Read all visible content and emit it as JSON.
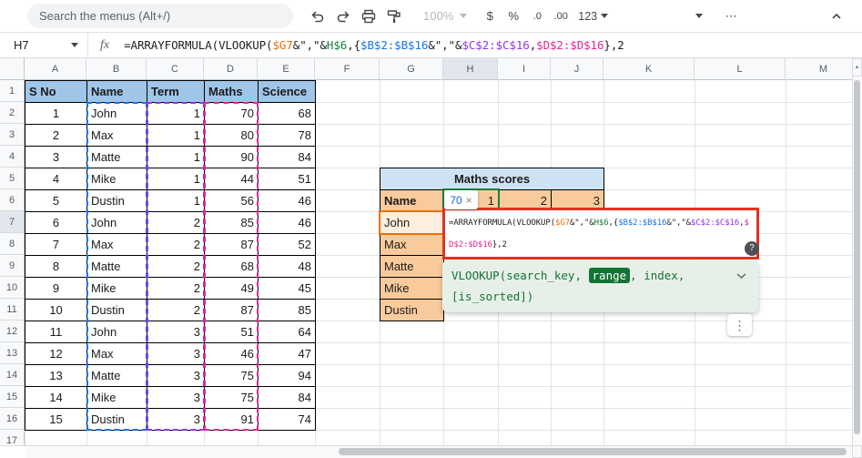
{
  "colors": {
    "ref_orange": "#e8710a",
    "ref_green": "#188038",
    "ref_blue": "#1a73e8",
    "ref_purple": "#9334e6",
    "ref_pink": "#e52592",
    "annotation_red": "#e43222",
    "table1_header_bg": "#9fc5e8",
    "table2_title_bg": "#cfe2f3",
    "table2_header_bg": "#f9cb9c",
    "referenced_cell_bg": "#fdeedd",
    "hint_bg": "#e7f0e8",
    "hint_green": "#137333"
  },
  "toolbar": {
    "search_label": "Search the menus (Alt+/)",
    "zoom_value": "100%",
    "currency_label": "$",
    "percent_label": "%",
    "decrease_decimal_label": ".0",
    "increase_decimal_label": ".00",
    "number_format_label": "123",
    "more_label": "⋯"
  },
  "formula_bar": {
    "cell_ref": "H7",
    "fx_label": "fx",
    "segments": [
      {
        "t": "=ARRAYFORMULA(VLOOKUP(",
        "c": null
      },
      {
        "t": "$G7",
        "c": "ref_orange"
      },
      {
        "t": "&\",\"&",
        "c": null
      },
      {
        "t": "H$6",
        "c": "ref_green"
      },
      {
        "t": ",{",
        "c": null
      },
      {
        "t": "$B$2:$B$16",
        "c": "ref_blue"
      },
      {
        "t": "&\",\"&",
        "c": null
      },
      {
        "t": "$C$2:$C$16",
        "c": "ref_purple"
      },
      {
        "t": ",",
        "c": null
      },
      {
        "t": "$D$2:$D$16",
        "c": "ref_pink"
      },
      {
        "t": "},2",
        "c": null
      }
    ]
  },
  "grid": {
    "column_headers": [
      "A",
      "B",
      "C",
      "D",
      "E",
      "F",
      "G",
      "H",
      "I",
      "J",
      "K",
      "L",
      "M"
    ],
    "row_headers": [
      "1",
      "2",
      "3",
      "4",
      "5",
      "6",
      "7",
      "8",
      "9",
      "10",
      "11",
      "12",
      "13",
      "14",
      "15",
      "16",
      "17"
    ],
    "selected_column": "H",
    "selected_row": "7"
  },
  "scores_table": {
    "headers": [
      "S No",
      "Name",
      "Term",
      "Maths",
      "Science"
    ],
    "rows": [
      [
        "1",
        "John",
        "1",
        "70",
        "68"
      ],
      [
        "2",
        "Max",
        "1",
        "80",
        "78"
      ],
      [
        "3",
        "Matte",
        "1",
        "90",
        "84"
      ],
      [
        "4",
        "Mike",
        "1",
        "44",
        "51"
      ],
      [
        "5",
        "Dustin",
        "1",
        "56",
        "46"
      ],
      [
        "6",
        "John",
        "2",
        "85",
        "46"
      ],
      [
        "7",
        "Max",
        "2",
        "87",
        "52"
      ],
      [
        "8",
        "Matte",
        "2",
        "68",
        "48"
      ],
      [
        "9",
        "Mike",
        "2",
        "49",
        "45"
      ],
      [
        "10",
        "Dustin",
        "2",
        "87",
        "85"
      ],
      [
        "11",
        "John",
        "3",
        "51",
        "64"
      ],
      [
        "12",
        "Max",
        "3",
        "46",
        "47"
      ],
      [
        "13",
        "Matte",
        "3",
        "75",
        "94"
      ],
      [
        "14",
        "Mike",
        "3",
        "75",
        "84"
      ],
      [
        "15",
        "Dustin",
        "3",
        "91",
        "74"
      ]
    ]
  },
  "pivot_table": {
    "title": "Maths scores",
    "row_header": "Name",
    "col_headers": [
      "1",
      "2",
      "3"
    ],
    "names": [
      "John",
      "Max",
      "Matte",
      "Mike",
      "Dustin"
    ]
  },
  "result_preview": {
    "value": "70",
    "close_label": "×"
  },
  "cell_editor": {
    "line1_segments": [
      {
        "t": "=ARRAYFORMULA(VLOOKUP(",
        "c": null
      },
      {
        "t": "$G7",
        "c": "ref_orange"
      },
      {
        "t": "&\",\"&",
        "c": null
      },
      {
        "t": "H$6",
        "c": "ref_green"
      },
      {
        "t": ",{",
        "c": null
      },
      {
        "t": "$B$2:$B$16",
        "c": "ref_blue"
      },
      {
        "t": "&\",\"&",
        "c": null
      },
      {
        "t": "$C$2:$C$16",
        "c": "ref_purple"
      },
      {
        "t": ",",
        "c": null
      },
      {
        "t": "$",
        "c": "ref_pink"
      }
    ],
    "line2_segments": [
      {
        "t": "D$2:$D$16",
        "c": "ref_pink"
      },
      {
        "t": "},2",
        "c": null
      }
    ]
  },
  "function_hint": {
    "fn_prefix": "VLOOKUP(search_key, ",
    "highlighted_param": "range",
    "fn_suffix_line1": ", index,",
    "fn_line2": "[is_sorted])",
    "help_label": "?",
    "more_label": "⋮",
    "scroll_up_glyph": "▲",
    "scroll_down_glyph": "▼"
  }
}
